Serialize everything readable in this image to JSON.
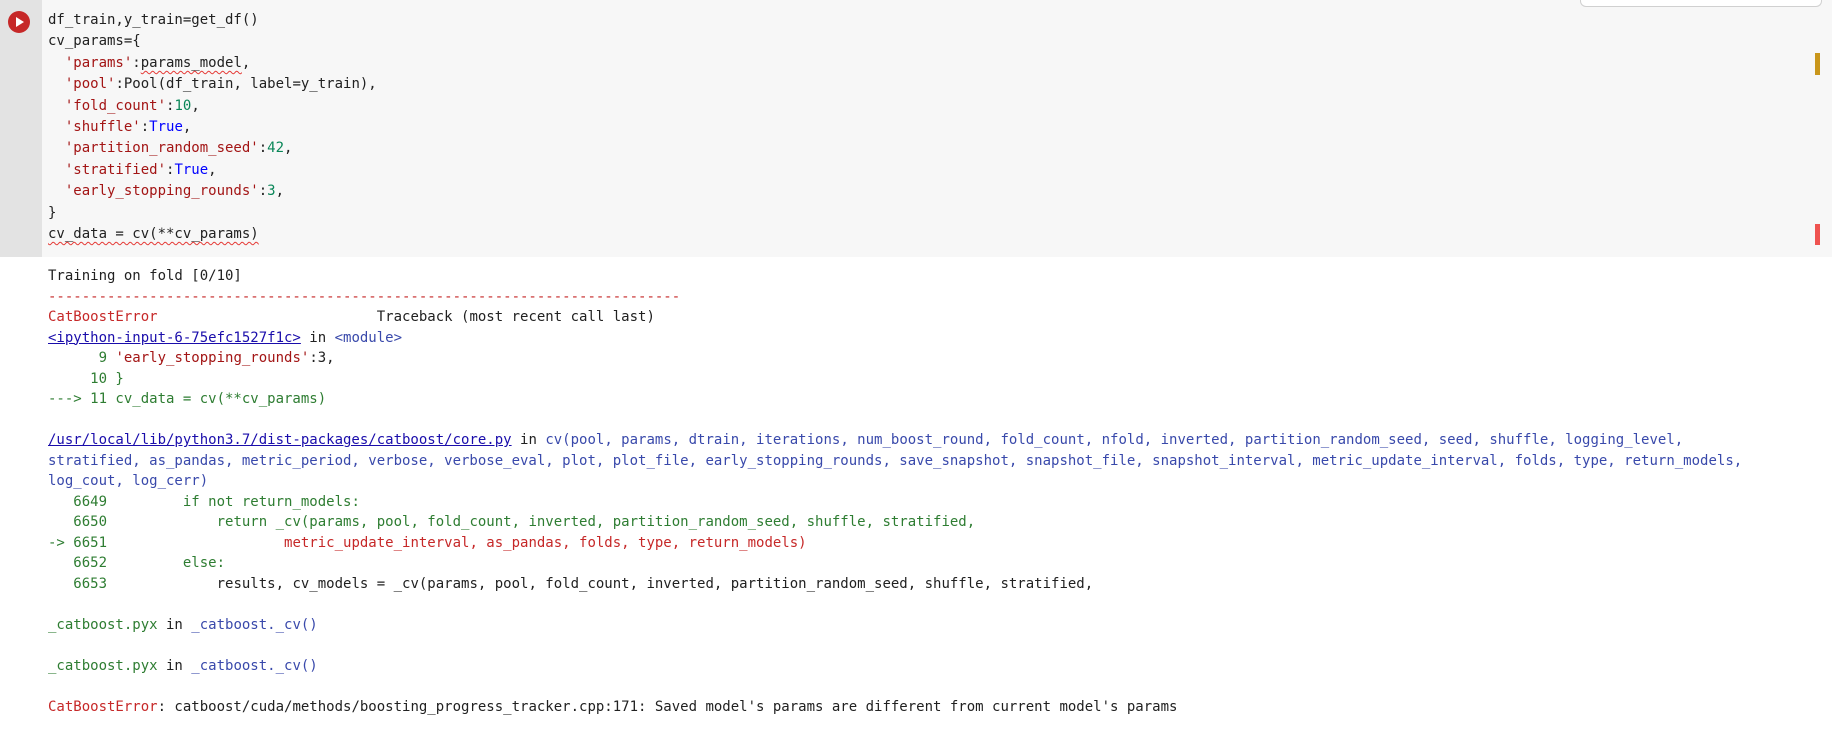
{
  "code_lines": [
    "df_train,y_train=get_df()",
    "cv_params={",
    "  'params':params_model,",
    "  'pool':Pool(df_train, label=y_train),",
    "  'fold_count':10,",
    "  'shuffle':True,",
    "  'partition_random_seed':42,",
    "  'stratified':True,",
    "  'early_stopping_rounds':3,",
    "}",
    "cv_data = cv(**cv_params)"
  ],
  "code_tokens": {
    "l0": "df_train,y_train=get_df()",
    "l1": "cv_params={",
    "l2_key": "'params'",
    "l2_val": "params_model",
    "l3_key": "'pool'",
    "l3_val": ":Pool(df_train, label=y_train),",
    "l4_key": "'fold_count'",
    "l4_val": "10",
    "l5_key": "'shuffle'",
    "l5_val": "True",
    "l6_key": "'partition_random_seed'",
    "l6_val": "42",
    "l7_key": "'stratified'",
    "l7_val": "True",
    "l8_key": "'early_stopping_rounds'",
    "l8_val": "3",
    "l9": "}",
    "l10": "cv_data = cv(**cv_params)"
  },
  "output": {
    "training_line": "Training on fold [0/10]",
    "dashes": "---------------------------------------------------------------------------",
    "error_name": "CatBoostError",
    "traceback_header": "                          Traceback (most recent call last)",
    "input_link": "<ipython-input-6-75efc1527f1c>",
    "in_word": " in ",
    "module": "<module>",
    "frame1": {
      "l9_num": "      9 ",
      "l9_key": "'early_stopping_rounds'",
      "l9_rest": ":3,",
      "l10": "     10 }",
      "arrow_line": "---> 11 cv_data = cv(**cv_params)"
    },
    "file_link": "/usr/local/lib/python3.7/dist-packages/catboost/core.py",
    "file_in": " in ",
    "signature_l1": "cv(pool, params, dtrain, iterations, num_boost_round, fold_count, nfold, inverted, partition_random_seed, seed, shuffle, logging_level,",
    "signature_l2": "stratified, as_pandas, metric_period, verbose, verbose_eval, plot, plot_file, early_stopping_rounds, save_snapshot, snapshot_file, snapshot_interval, metric_update_interval, folds, type, return_models,",
    "signature_l3": "log_cout, log_cerr)",
    "frame2": {
      "n6649": "   6649 ",
      "t6649": "        if not return_models:",
      "n6650": "   6650 ",
      "t6650": "            return _cv(params, pool, fold_count, inverted, partition_random_seed, shuffle, stratified,",
      "n6651": "-> 6651 ",
      "t6651": "                    metric_update_interval, as_pandas, folds, type, return_models)",
      "n6652": "   6652 ",
      "t6652": "        else:",
      "n6653": "   6653 ",
      "t6653": "            results, cv_models = _cv(params, pool, fold_count, inverted, partition_random_seed, shuffle, stratified,"
    },
    "pyx1_file": "_catboost.pyx",
    "pyx1_in": " in ",
    "pyx1_func": "_catboost._cv()",
    "pyx2_file": "_catboost.pyx",
    "pyx2_in": " in ",
    "pyx2_func": "_catboost._cv()",
    "final_error_name": "CatBoostError",
    "final_error_msg": ": catboost/cuda/methods/boosting_progress_tracker.cpp:171: Saved model's params are different from current model's params"
  },
  "icons": [
    "run-cell-icon"
  ],
  "colors": {
    "run_button": "#c62828",
    "error": "#c62828",
    "string": "#a31515",
    "number": "#098658",
    "keyword": "#0000ff"
  }
}
